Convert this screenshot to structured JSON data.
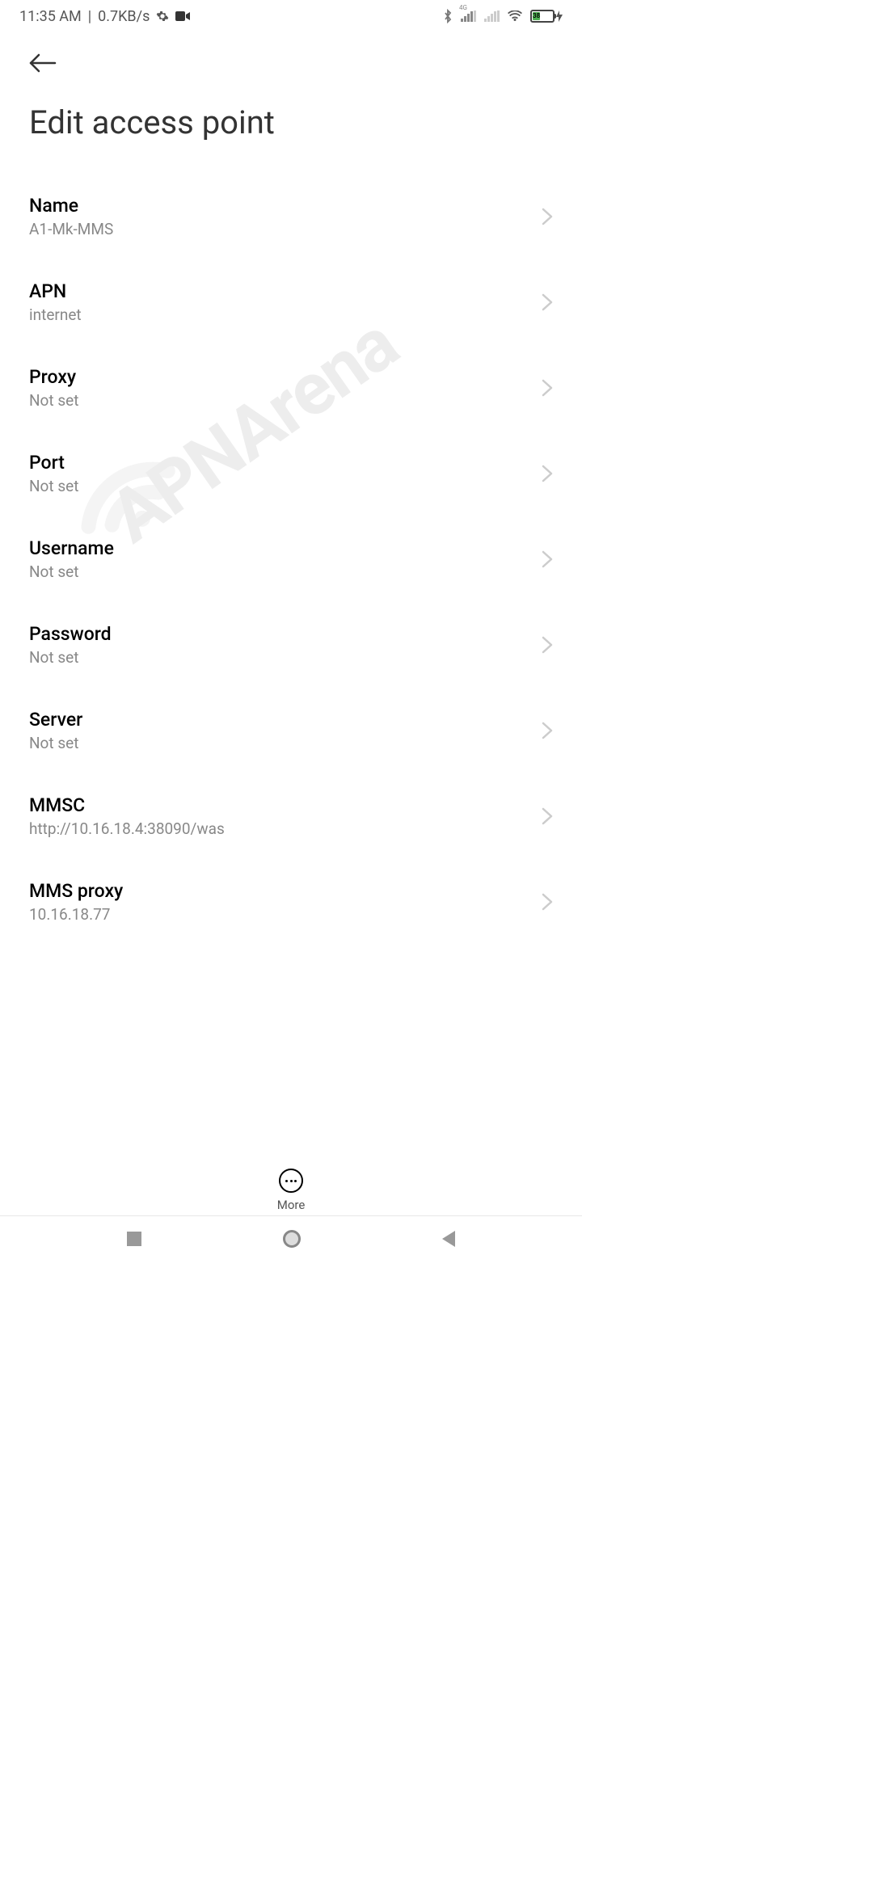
{
  "statusBar": {
    "time": "11:35 AM",
    "dataRate": "0.7KB/s",
    "networkLabel": "4G",
    "batteryPercent": "38"
  },
  "header": {
    "title": "Edit access point"
  },
  "settings": [
    {
      "label": "Name",
      "value": "A1-Mk-MMS"
    },
    {
      "label": "APN",
      "value": "internet"
    },
    {
      "label": "Proxy",
      "value": "Not set"
    },
    {
      "label": "Port",
      "value": "Not set"
    },
    {
      "label": "Username",
      "value": "Not set"
    },
    {
      "label": "Password",
      "value": "Not set"
    },
    {
      "label": "Server",
      "value": "Not set"
    },
    {
      "label": "MMSC",
      "value": "http://10.16.18.4:38090/was"
    },
    {
      "label": "MMS proxy",
      "value": "10.16.18.77"
    }
  ],
  "bottomAction": {
    "moreLabel": "More"
  },
  "watermark": "APNArena"
}
